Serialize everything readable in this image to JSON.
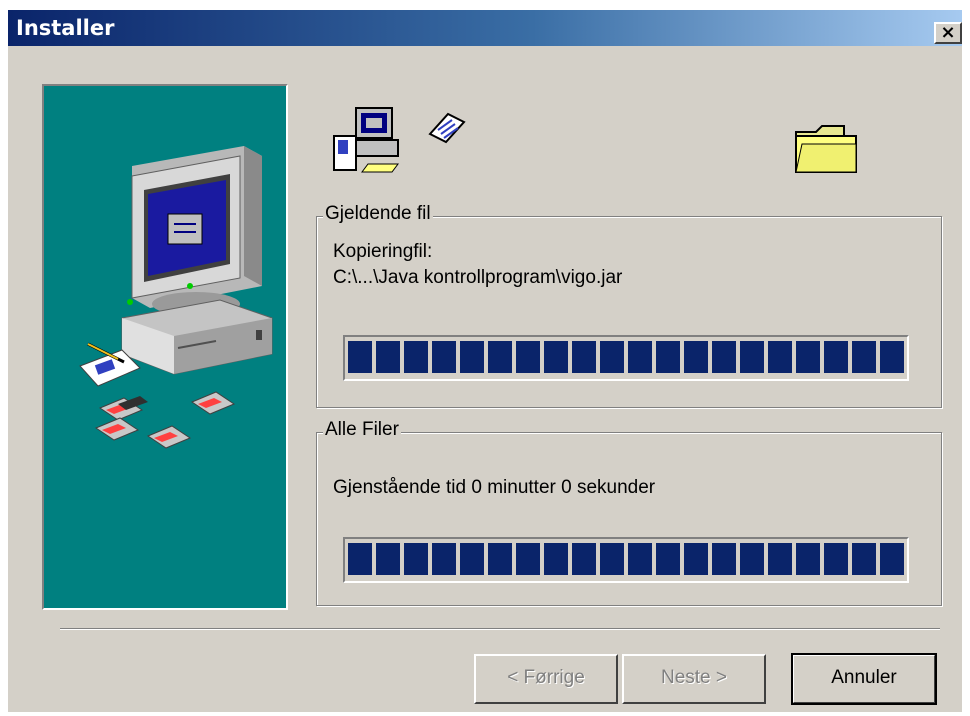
{
  "window": {
    "title": "Installer"
  },
  "current_file": {
    "group_label": "Gjeldende fil",
    "line1": "Kopieringfil:",
    "line2": "C:\\...\\Java kontrollprogram\\vigo.jar",
    "progress_fraction": 1.0
  },
  "all_files": {
    "group_label": "Alle Filer",
    "remaining": "Gjenstående tid 0 minutter 0 sekunder",
    "progress_fraction": 1.0
  },
  "buttons": {
    "back": "< Førrige",
    "next": "Neste >",
    "cancel": "Annuler"
  },
  "colors": {
    "progress": "#0a246a",
    "panel": "#008080",
    "face": "#d4d0c8"
  },
  "icons": [
    "computer-setup-icon",
    "flying-document-icon",
    "folder-icon",
    "computer-illustration-icon"
  ]
}
